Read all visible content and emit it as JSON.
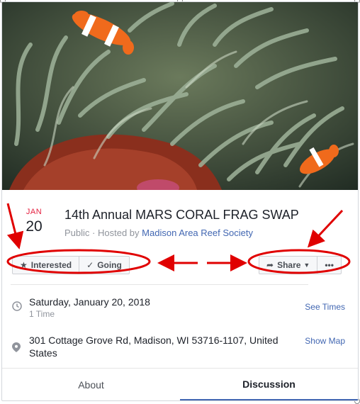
{
  "event": {
    "month": "JAN",
    "day": "20",
    "title": "14th Annual MARS CORAL FRAG SWAP",
    "privacy": "Public",
    "hosted_by_prefix": "Hosted by",
    "host": "Madison Area Reef Society"
  },
  "actions": {
    "interested_label": "Interested",
    "going_label": "Going",
    "share_label": "Share",
    "more_label": "•••"
  },
  "details": {
    "date": "Saturday, January 20, 2018",
    "date_sub": "1 Time",
    "see_times_label": "See Times",
    "address": "301 Cottage Grove Rd, Madison, WI 53716-1107, United States",
    "show_map_label": "Show Map"
  },
  "tabs": [
    {
      "label": "About",
      "active": false
    },
    {
      "label": "Discussion",
      "active": true
    }
  ],
  "colors": {
    "annotation": "#e00000",
    "link": "#4267b2",
    "month": "#e41e3f"
  }
}
